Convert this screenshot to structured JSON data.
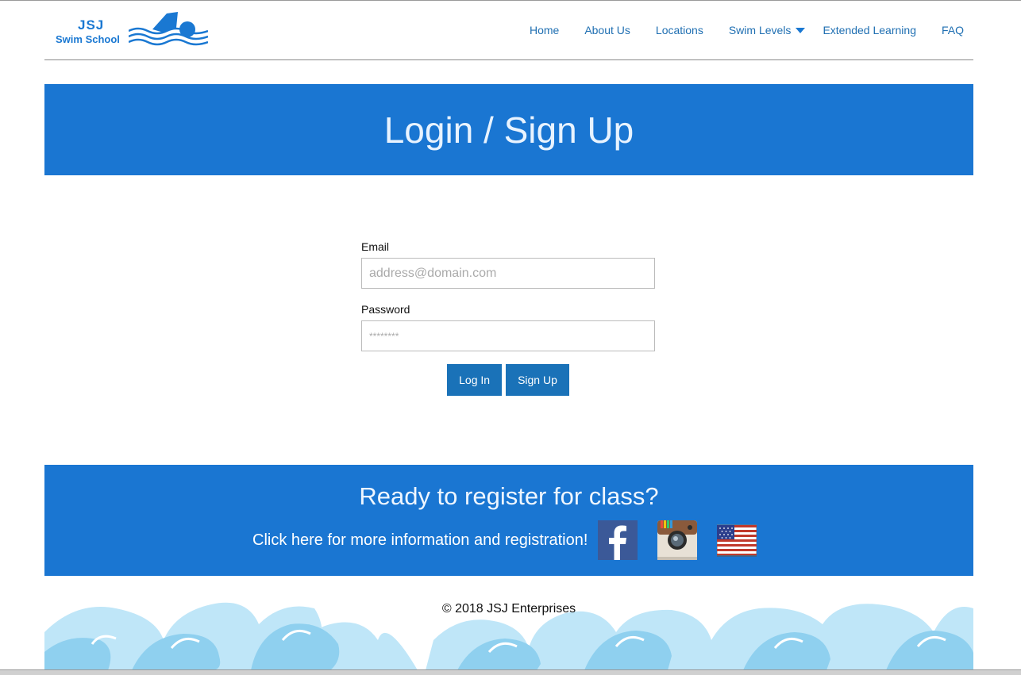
{
  "brand": {
    "line1": "JSJ",
    "line2": "Swim School"
  },
  "nav": {
    "items": [
      "Home",
      "About Us",
      "Locations",
      "Swim Levels",
      "Extended Learning",
      "FAQ"
    ]
  },
  "hero": {
    "title": "Login / Sign Up"
  },
  "form": {
    "email_label": "Email",
    "email_placeholder": "address@domain.com",
    "password_label": "Password",
    "password_placeholder": "********",
    "login_label": "Log In",
    "signup_label": "Sign Up"
  },
  "cta": {
    "heading": "Ready to register for class?",
    "link_text": "Click here for more information and registration!"
  },
  "footer": {
    "copyright": "© 2018 JSJ Enterprises"
  },
  "colors": {
    "brand_blue": "#1a76d2",
    "button_blue": "#1a72b8",
    "nav_link": "#1f6fb2"
  },
  "icons": [
    "swimmer-logo-icon",
    "dropdown-caret-icon",
    "facebook-icon",
    "instagram-icon",
    "us-flag-icon"
  ]
}
